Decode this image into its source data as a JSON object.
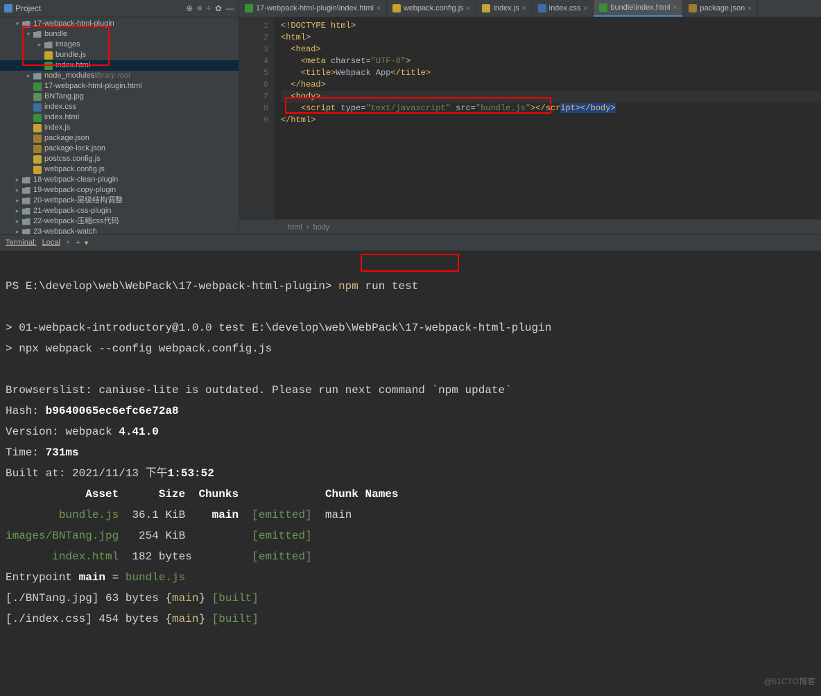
{
  "project": {
    "title": "Project",
    "toolbar": [
      "target-icon",
      "collapse-all-icon",
      "expand-icon",
      "settings-icon",
      "hide-icon"
    ],
    "tree": [
      {
        "depth": 0,
        "arrow": "v",
        "icon": "folder",
        "label": "17-webpack-html-plugin"
      },
      {
        "depth": 1,
        "arrow": "v",
        "icon": "folder",
        "label": "bundle"
      },
      {
        "depth": 2,
        "arrow": ">",
        "icon": "folder",
        "label": "images"
      },
      {
        "depth": 2,
        "arrow": "",
        "icon": "js",
        "label": "bundle.js"
      },
      {
        "depth": 2,
        "arrow": "",
        "icon": "html",
        "label": "index.html",
        "selected": true
      },
      {
        "depth": 1,
        "arrow": ">",
        "icon": "folder",
        "label": "node_modules",
        "dim": "library root"
      },
      {
        "depth": 1,
        "arrow": "",
        "icon": "html",
        "label": "17-webpack-html-plugin.html"
      },
      {
        "depth": 1,
        "arrow": "",
        "icon": "img",
        "label": "BNTang.jpg"
      },
      {
        "depth": 1,
        "arrow": "",
        "icon": "css",
        "label": "index.css"
      },
      {
        "depth": 1,
        "arrow": "",
        "icon": "html",
        "label": "index.html"
      },
      {
        "depth": 1,
        "arrow": "",
        "icon": "js",
        "label": "index.js"
      },
      {
        "depth": 1,
        "arrow": "",
        "icon": "json",
        "label": "package.json"
      },
      {
        "depth": 1,
        "arrow": "",
        "icon": "json",
        "label": "package-lock.json"
      },
      {
        "depth": 1,
        "arrow": "",
        "icon": "js",
        "label": "postcss.config.js"
      },
      {
        "depth": 1,
        "arrow": "",
        "icon": "js",
        "label": "webpack.config.js"
      },
      {
        "depth": 0,
        "arrow": ">",
        "icon": "folder",
        "label": "18-webpack-clean-plugin"
      },
      {
        "depth": 0,
        "arrow": ">",
        "icon": "folder",
        "label": "19-webpack-copy-plugin"
      },
      {
        "depth": 0,
        "arrow": ">",
        "icon": "folder",
        "label": "20-webpack-层级结构调整"
      },
      {
        "depth": 0,
        "arrow": ">",
        "icon": "folder",
        "label": "21-webpack-css-plugin"
      },
      {
        "depth": 0,
        "arrow": ">",
        "icon": "folder",
        "label": "22-webpack-压缩css代码"
      },
      {
        "depth": 0,
        "arrow": ">",
        "icon": "folder",
        "label": "23-webpack-watch"
      }
    ]
  },
  "tabs": [
    {
      "icon": "html",
      "label": "17-webpack-html-plugin\\index.html",
      "close": true
    },
    {
      "icon": "js",
      "label": "webpack.config.js",
      "close": true
    },
    {
      "icon": "js",
      "label": "index.js",
      "close": true
    },
    {
      "icon": "css",
      "label": "index.css",
      "close": true
    },
    {
      "icon": "html",
      "label": "bundle\\index.html",
      "close": true,
      "active": true
    },
    {
      "icon": "json",
      "label": "package.json",
      "close": true
    }
  ],
  "editor": {
    "lineNumbers": [
      "1",
      "2",
      "3",
      "4",
      "5",
      "6",
      "7",
      "8",
      "9"
    ],
    "lines": {
      "l1": "<!DOCTYPE html>",
      "l2": "<html>",
      "l3": "<head>",
      "l4_a": "<meta ",
      "l4_b": "charset=",
      "l4_c": "\"UTF-8\"",
      "l4_d": ">",
      "l5_a": "<title>",
      "l5_b": "Webpack App",
      "l5_c": "</title>",
      "l6": "</head>",
      "l7": "<body>",
      "l8_a": "<script ",
      "l8_b": "type=",
      "l8_c": "\"text/javascript\"",
      "l8_d": " src=",
      "l8_e": "\"bundle.js\"",
      "l8_f": "></scr",
      "l8_f2": "ipt></body>",
      "l9": "</html>"
    }
  },
  "breadcrumb": [
    "html",
    "body"
  ],
  "terminal": {
    "title": "Terminal:",
    "tab": "Local",
    "promptPrefix": "PS E:\\develop\\web\\WebPack\\17-webpack-html-plugin> ",
    "cmd_npm": "npm",
    "cmd_rest": " run test",
    "blank": "",
    "line_pkg": "> 01-webpack-introductory@1.0.0 test E:\\develop\\web\\WebPack\\17-webpack-html-plugin",
    "line_npx": "> npx webpack --config webpack.config.js",
    "line_browserslist": "Browserslist: caniuse-lite is outdated. Please run next command `npm update`",
    "hash_lbl": "Hash: ",
    "hash_val": "b9640065ec6efc6e72a8",
    "ver_lbl": "Version: webpack ",
    "ver_val": "4.41.0",
    "time_lbl": "Time: ",
    "time_val": "731ms",
    "built_lbl": "Built at: 2021/11/13 下午",
    "built_val": "1:53:52",
    "table_header": "            Asset      Size  Chunks             Chunk Names",
    "row1_asset": "        bundle.js",
    "row1_rest": "  36.1 KiB    ",
    "row1_chunk": "main",
    "row1_emit": "  [emitted]  ",
    "row1_names": "main",
    "row2_asset": "images/BNTang.jpg",
    "row2_rest": "   254 KiB        ",
    "row2_emit": "  [emitted]  ",
    "row3_asset": "       index.html",
    "row3_rest": "  182 bytes       ",
    "row3_emit": "  [emitted]  ",
    "entry_a": "Entrypoint ",
    "entry_b": "main",
    "entry_c": " = ",
    "entry_d": "bundle.js",
    "mod1_a": "[./BNTang.jpg] 63 bytes {",
    "mod1_b": "main",
    "mod1_c": "} ",
    "mod1_d": "[built]",
    "mod2_a": "[./index.css] 454 bytes {",
    "mod2_b": "main",
    "mod2_c": "} ",
    "mod2_d": "[built]"
  },
  "watermark": "@51CTO博客"
}
